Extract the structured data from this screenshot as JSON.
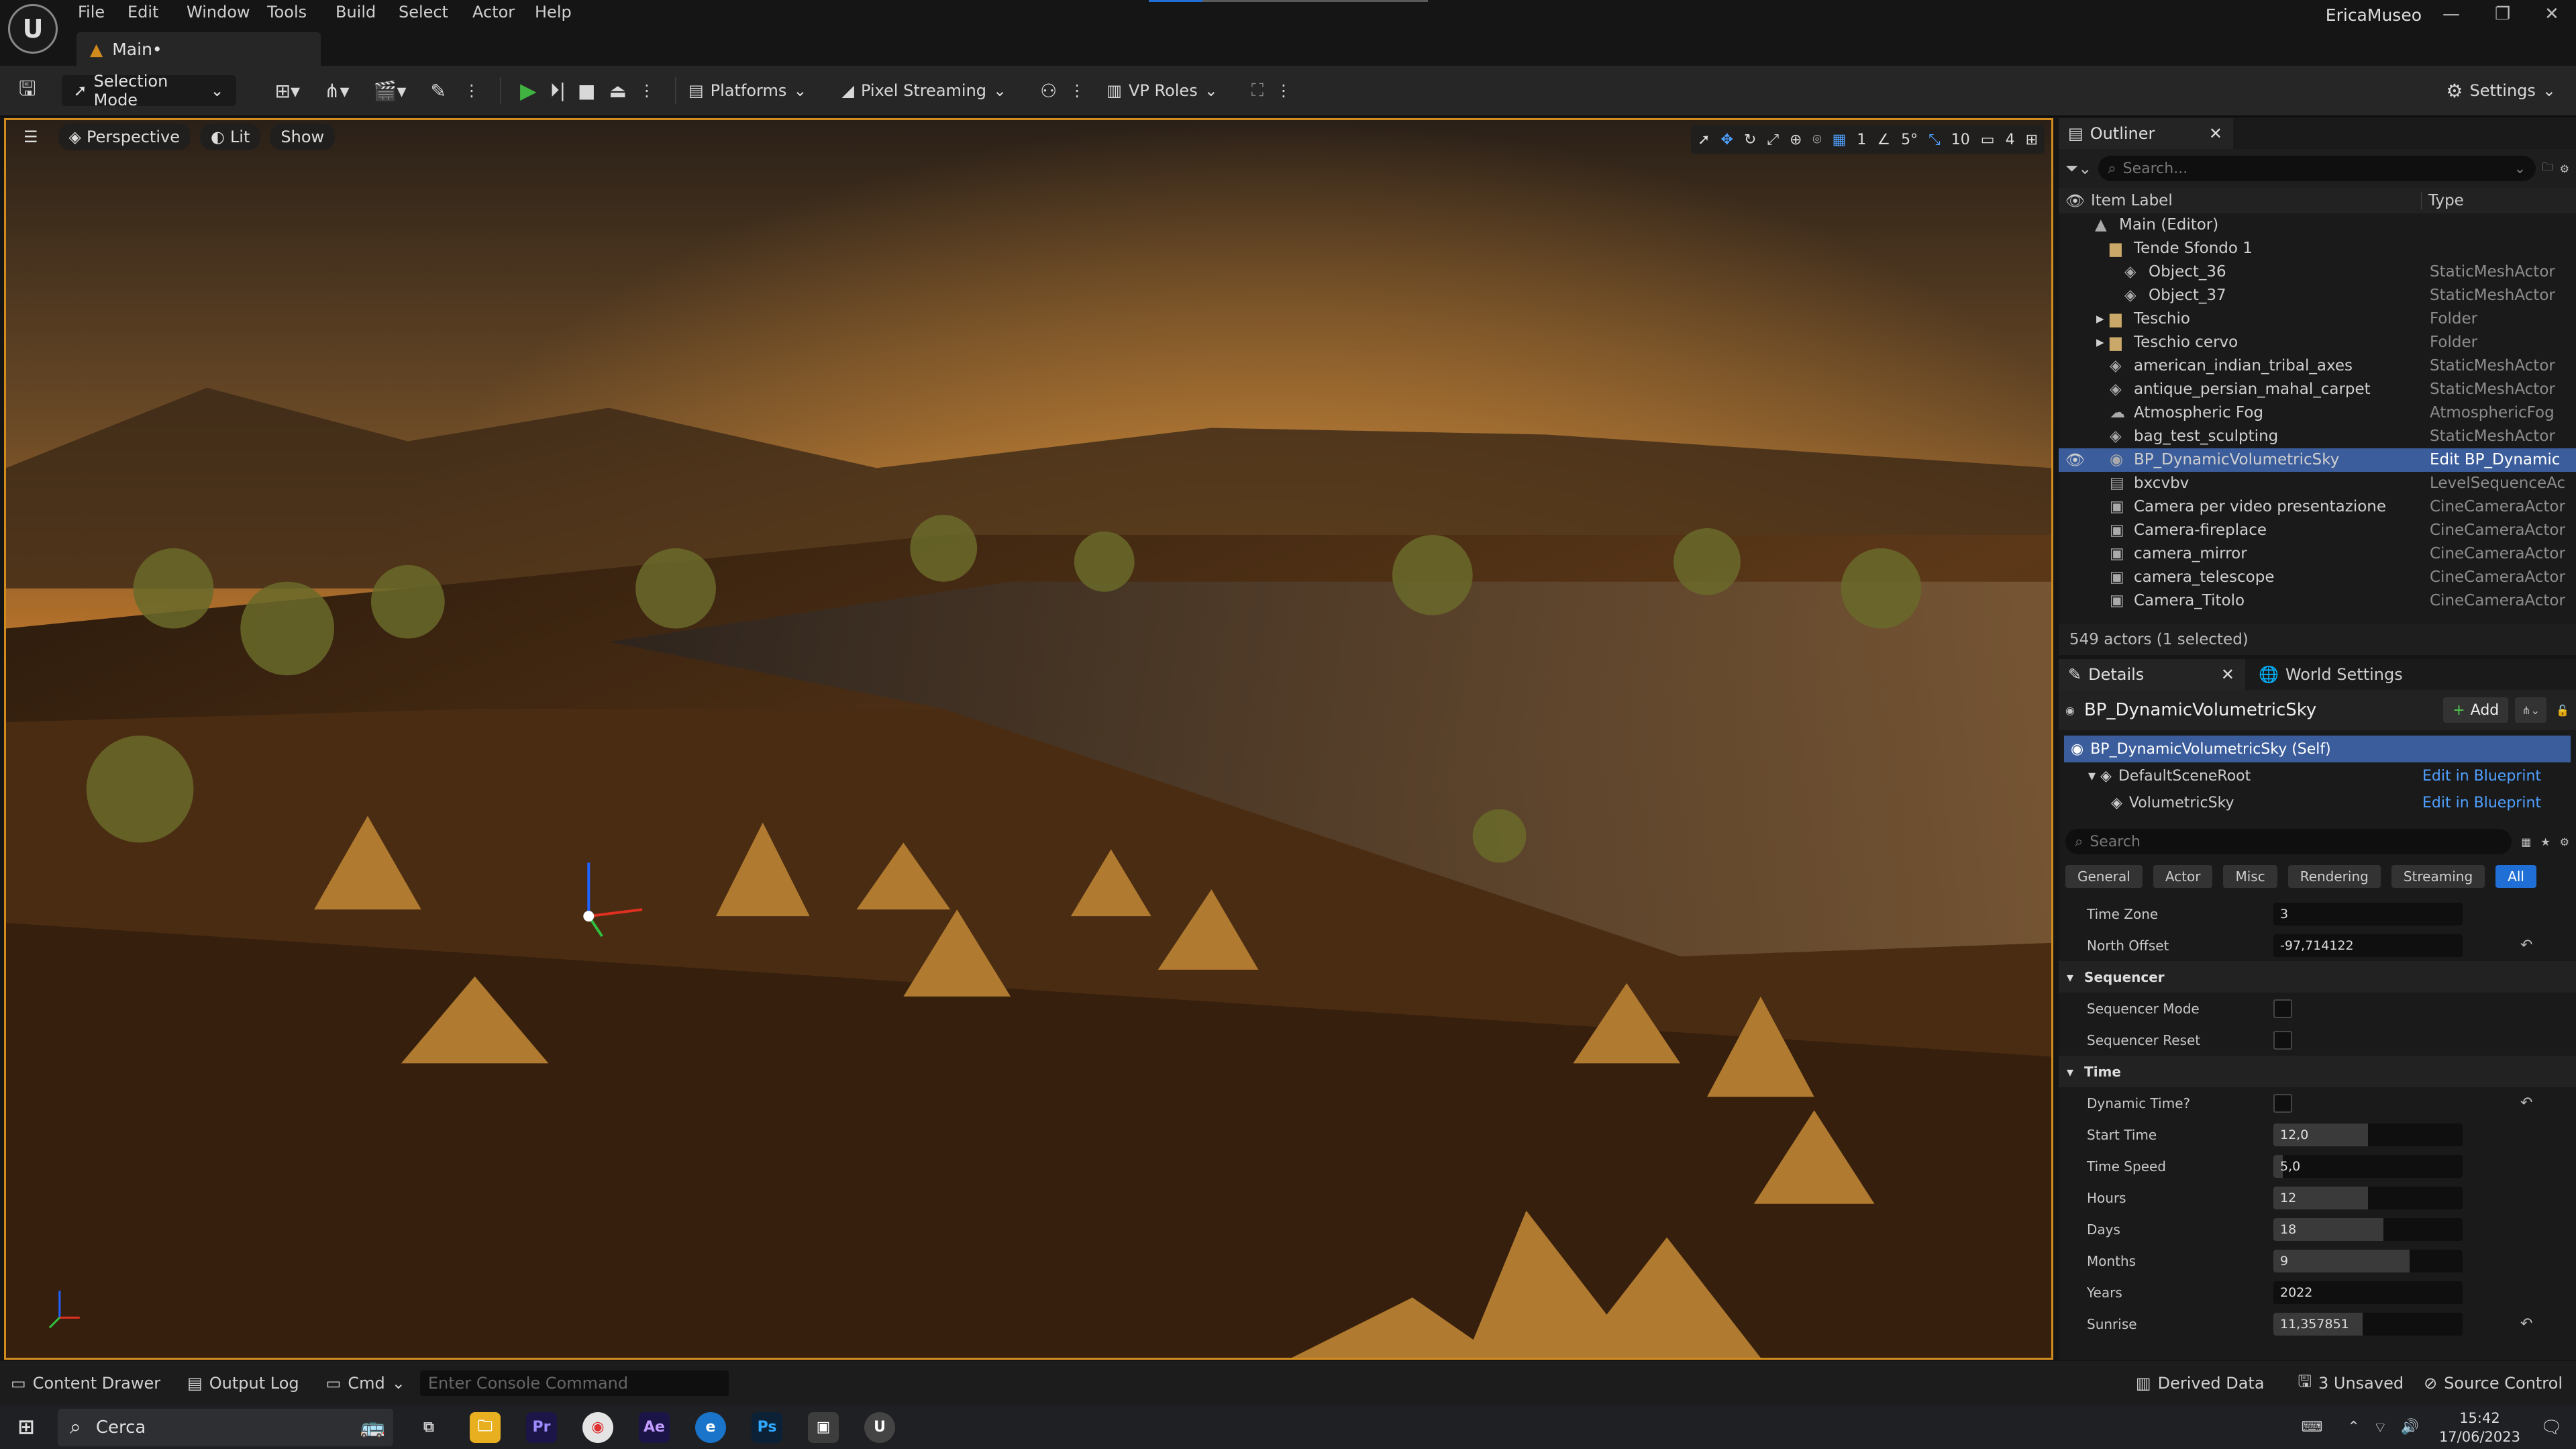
{
  "menu": {
    "items": [
      "File",
      "Edit",
      "Window",
      "Tools",
      "Build",
      "Select",
      "Actor",
      "Help"
    ],
    "user": "EricaMuseo",
    "doc_tab": "Main•"
  },
  "toolbar": {
    "selection_mode": "Selection Mode",
    "platforms": "Platforms",
    "pixel_streaming": "Pixel Streaming",
    "vp_roles": "VP Roles",
    "settings": "Settings"
  },
  "viewport": {
    "perspective": "Perspective",
    "lit": "Lit",
    "show": "Show",
    "grid_snap": "1",
    "rot_snap": "5°",
    "scale_snap": "10",
    "cam_speed": "4"
  },
  "outliner": {
    "tab": "Outliner",
    "search_placeholder": "Search...",
    "col_label": "Item Label",
    "col_type": "Type",
    "rows": [
      {
        "label": "Main (Editor)",
        "type": "",
        "indent": 0,
        "icon": "map-icon",
        "arrow": ""
      },
      {
        "label": "Tende Sfondo 1",
        "type": "",
        "indent": 1,
        "icon": "folder-icon",
        "arrow": ""
      },
      {
        "label": "Object_36",
        "type": "StaticMeshActor",
        "indent": 2,
        "icon": "mesh-icon",
        "arrow": ""
      },
      {
        "label": "Object_37",
        "type": "StaticMeshActor",
        "indent": 2,
        "icon": "mesh-icon",
        "arrow": ""
      },
      {
        "label": "Teschio",
        "type": "Folder",
        "indent": 1,
        "icon": "folder-icon",
        "arrow": "▸"
      },
      {
        "label": "Teschio cervo",
        "type": "Folder",
        "indent": 1,
        "icon": "folder-icon",
        "arrow": "▸"
      },
      {
        "label": "american_indian_tribal_axes",
        "type": "StaticMeshActor",
        "indent": 1,
        "icon": "mesh-icon",
        "arrow": ""
      },
      {
        "label": "antique_persian_mahal_carpet",
        "type": "StaticMeshActor",
        "indent": 1,
        "icon": "mesh-icon",
        "arrow": ""
      },
      {
        "label": "Atmospheric Fog",
        "type": "AtmosphericFog",
        "indent": 1,
        "icon": "fog-icon",
        "arrow": ""
      },
      {
        "label": "bag_test_sculpting",
        "type": "StaticMeshActor",
        "indent": 1,
        "icon": "mesh-icon",
        "arrow": ""
      },
      {
        "label": "BP_DynamicVolumetricSky",
        "type": "Edit BP_Dynamic",
        "indent": 1,
        "icon": "blueprint-icon",
        "arrow": "",
        "selected": true
      },
      {
        "label": "bxcvbv",
        "type": "LevelSequenceAc",
        "indent": 1,
        "icon": "sequence-icon",
        "arrow": ""
      },
      {
        "label": "Camera per video presentazione",
        "type": "CineCameraActor",
        "indent": 1,
        "icon": "camera-icon",
        "arrow": ""
      },
      {
        "label": "Camera-fireplace",
        "type": "CineCameraActor",
        "indent": 1,
        "icon": "camera-icon",
        "arrow": ""
      },
      {
        "label": "camera_mirror",
        "type": "CineCameraActor",
        "indent": 1,
        "icon": "camera-icon",
        "arrow": ""
      },
      {
        "label": "camera_telescope",
        "type": "CineCameraActor",
        "indent": 1,
        "icon": "camera-icon",
        "arrow": ""
      },
      {
        "label": "Camera_Titolo",
        "type": "CineCameraActor",
        "indent": 1,
        "icon": "camera-icon",
        "arrow": ""
      }
    ],
    "status": "549 actors (1 selected)"
  },
  "details": {
    "tab": "Details",
    "tab2": "World Settings",
    "object": "BP_DynamicVolumetricSky",
    "add": "Add",
    "components": [
      {
        "label": "BP_DynamicVolumetricSky (Self)",
        "link": ""
      },
      {
        "label": "DefaultSceneRoot",
        "link": "Edit in Blueprint"
      },
      {
        "label": "VolumetricSky",
        "link": "Edit in Blueprint"
      }
    ],
    "search_placeholder": "Search",
    "filters": [
      "General",
      "Actor",
      "Misc",
      "Rendering",
      "Streaming",
      "All"
    ],
    "props": [
      {
        "kind": "field",
        "label": "Time Zone",
        "value": "3",
        "fill": 0,
        "reset": false
      },
      {
        "kind": "field",
        "label": "North Offset",
        "value": "-97,714122",
        "fill": 0,
        "reset": true
      },
      {
        "kind": "cat",
        "label": "Sequencer"
      },
      {
        "kind": "check",
        "label": "Sequencer Mode",
        "reset": false
      },
      {
        "kind": "check",
        "label": "Sequencer Reset",
        "reset": false
      },
      {
        "kind": "cat",
        "label": "Time"
      },
      {
        "kind": "check",
        "label": "Dynamic Time?",
        "reset": true
      },
      {
        "kind": "field",
        "label": "Start Time",
        "value": "12,0",
        "fill": 0.5,
        "reset": false
      },
      {
        "kind": "field",
        "label": "Time Speed",
        "value": "5,0",
        "fill": 0.05,
        "reset": false
      },
      {
        "kind": "field",
        "label": "Hours",
        "value": "12",
        "fill": 0.5,
        "reset": false
      },
      {
        "kind": "field",
        "label": "Days",
        "value": "18",
        "fill": 0.58,
        "reset": false
      },
      {
        "kind": "field",
        "label": "Months",
        "value": "9",
        "fill": 0.72,
        "reset": false
      },
      {
        "kind": "field",
        "label": "Years",
        "value": "2022",
        "fill": 0,
        "reset": false
      },
      {
        "kind": "field",
        "label": "Sunrise",
        "value": "11,357851",
        "fill": 0.47,
        "reset": true
      }
    ]
  },
  "statusbar": {
    "content_drawer": "Content Drawer",
    "output_log": "Output Log",
    "cmd": "Cmd",
    "console_placeholder": "Enter Console Command",
    "derived_data": "Derived Data",
    "unsaved": "3 Unsaved",
    "source_control": "Source Control"
  },
  "taskbar": {
    "search": "Cerca",
    "time": "15:42",
    "date": "17/06/2023"
  }
}
